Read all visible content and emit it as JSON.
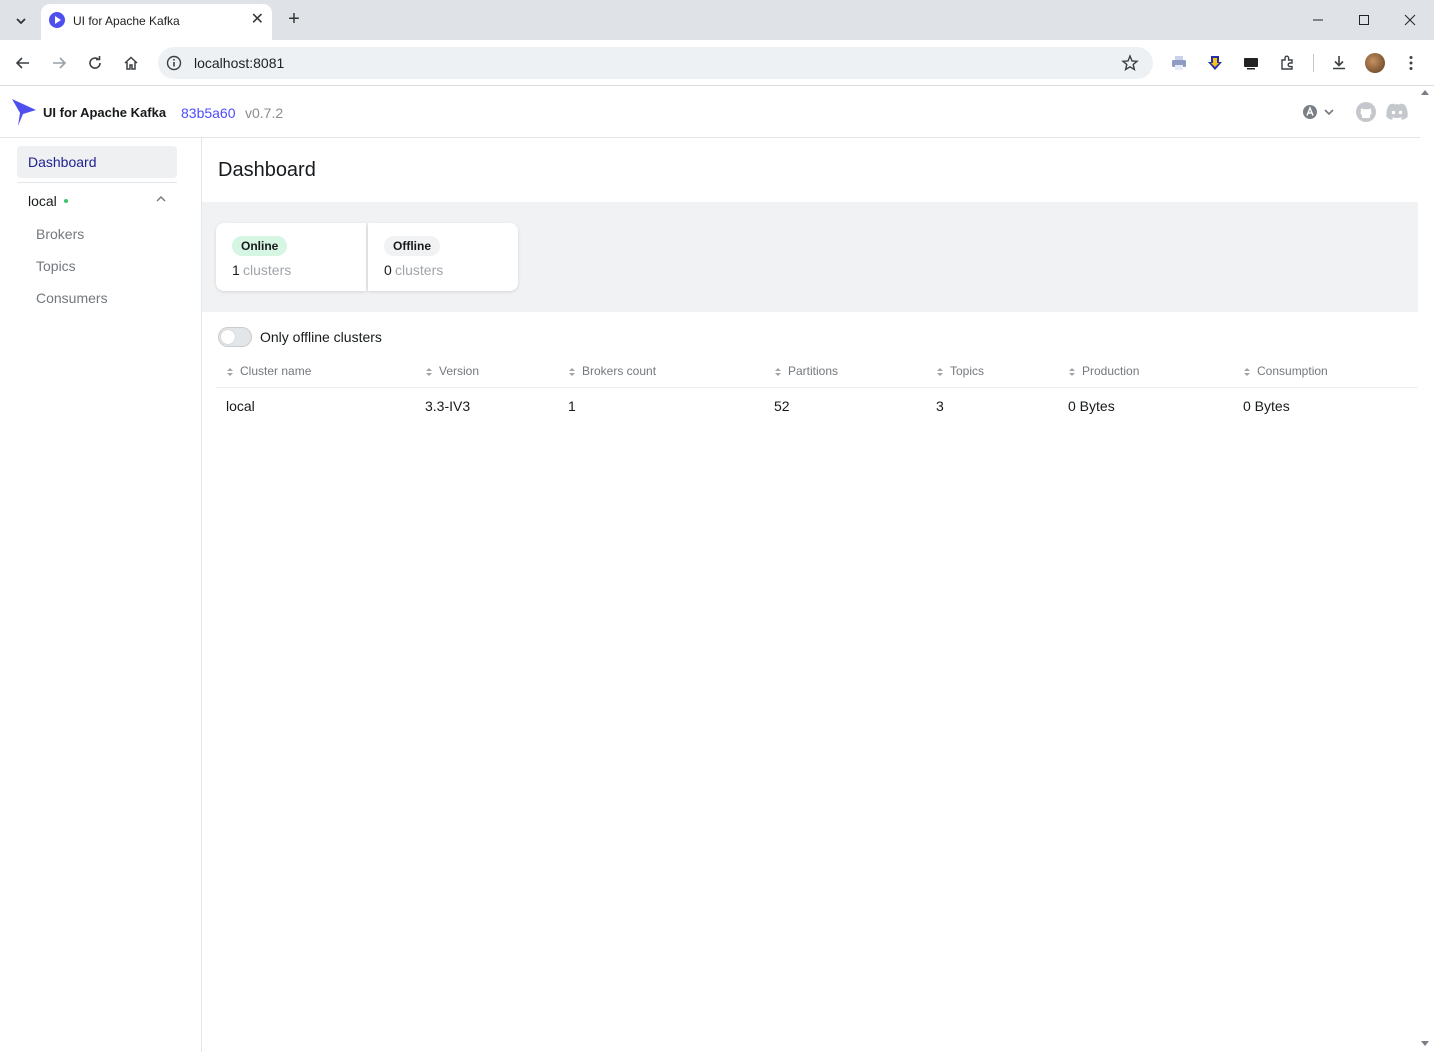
{
  "browser": {
    "tab_title": "UI for Apache Kafka",
    "url": "localhost:8081"
  },
  "header": {
    "app_name": "UI for Apache Kafka",
    "commit": "83b5a60",
    "version": "v0.7.2"
  },
  "sidebar": {
    "dashboard_label": "Dashboard",
    "cluster_name": "local",
    "cluster_status_color": "#3ec46d",
    "links": [
      "Brokers",
      "Topics",
      "Consumers"
    ]
  },
  "main": {
    "title": "Dashboard",
    "stats": {
      "online_label": "Online",
      "online_count": "1",
      "offline_label": "Offline",
      "offline_count": "0",
      "unit": "clusters"
    },
    "toggle_label": "Only offline clusters",
    "table": {
      "columns": [
        "Cluster name",
        "Version",
        "Brokers count",
        "Partitions",
        "Topics",
        "Production",
        "Consumption"
      ],
      "rows": [
        [
          "local",
          "3.3-IV3",
          "1",
          "52",
          "3",
          "0 Bytes",
          "0 Bytes"
        ]
      ]
    }
  },
  "colors": {
    "accent": "#4c4cff",
    "online_pill": "#d6f5e3"
  }
}
